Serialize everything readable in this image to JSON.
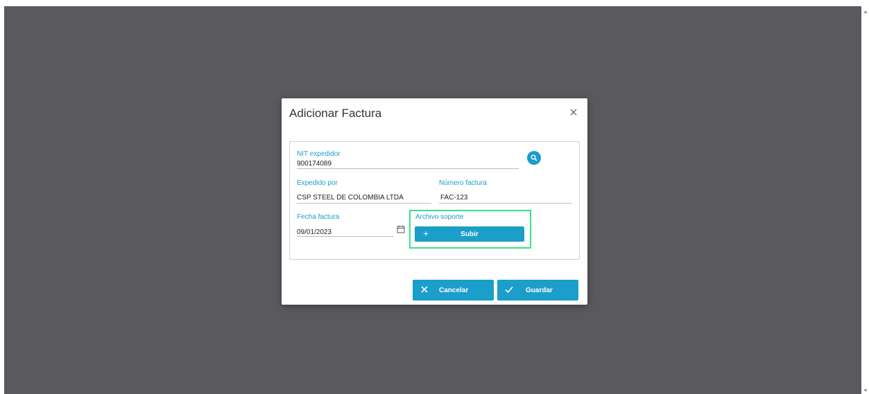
{
  "dialog": {
    "title": "Adicionar Factura",
    "close_icon": "close-icon"
  },
  "form": {
    "nit": {
      "label": "NIT expedidor",
      "value": "900174089"
    },
    "expedido_por": {
      "label": "Expedido por",
      "value": "CSP STEEL DE COLOMBIA LTDA"
    },
    "numero_factura": {
      "label": "Número factura",
      "value": "FAC-123"
    },
    "fecha_factura": {
      "label": "Fecha factura",
      "value": "09/01/2023"
    },
    "archivo_soporte": {
      "label": "Archivo soporte",
      "button_label": "Subir"
    }
  },
  "actions": {
    "cancel_label": "Cancelar",
    "save_label": "Guardar"
  },
  "colors": {
    "accent": "#1b9ec9",
    "overlay": "#5a595e",
    "highlight": "#35e38a"
  }
}
